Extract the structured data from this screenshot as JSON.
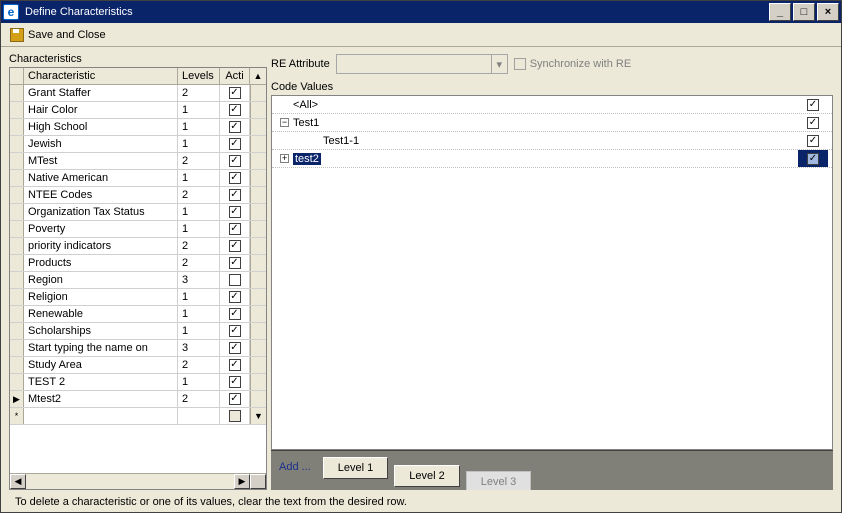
{
  "window": {
    "title": "Define Characteristics"
  },
  "toolbar": {
    "save_close": "Save and Close"
  },
  "left": {
    "heading": "Characteristics",
    "columns": {
      "char": "Characteristic",
      "levels": "Levels",
      "active": "Acti"
    },
    "rows": [
      {
        "name": "Grant Staffer",
        "levels": "2",
        "active": true,
        "marker": ""
      },
      {
        "name": "Hair Color",
        "levels": "1",
        "active": true,
        "marker": ""
      },
      {
        "name": "High School",
        "levels": "1",
        "active": true,
        "marker": ""
      },
      {
        "name": "Jewish",
        "levels": "1",
        "active": true,
        "marker": ""
      },
      {
        "name": "MTest",
        "levels": "2",
        "active": true,
        "marker": ""
      },
      {
        "name": "Native American",
        "levels": "1",
        "active": true,
        "marker": ""
      },
      {
        "name": "NTEE Codes",
        "levels": "2",
        "active": true,
        "marker": ""
      },
      {
        "name": "Organization Tax Status",
        "levels": "1",
        "active": true,
        "marker": ""
      },
      {
        "name": "Poverty",
        "levels": "1",
        "active": true,
        "marker": ""
      },
      {
        "name": "priority indicators",
        "levels": "2",
        "active": true,
        "marker": ""
      },
      {
        "name": "Products",
        "levels": "2",
        "active": true,
        "marker": ""
      },
      {
        "name": "Region",
        "levels": "3",
        "active": false,
        "marker": ""
      },
      {
        "name": "Religion",
        "levels": "1",
        "active": true,
        "marker": ""
      },
      {
        "name": "Renewable",
        "levels": "1",
        "active": true,
        "marker": ""
      },
      {
        "name": "Scholarships",
        "levels": "1",
        "active": true,
        "marker": ""
      },
      {
        "name": "Start typing the name on",
        "levels": "3",
        "active": true,
        "marker": ""
      },
      {
        "name": "Study Area",
        "levels": "2",
        "active": true,
        "marker": ""
      },
      {
        "name": "TEST 2",
        "levels": "1",
        "active": true,
        "marker": ""
      },
      {
        "name": "Mtest2",
        "levels": "2",
        "active": true,
        "marker": "▶"
      }
    ]
  },
  "right": {
    "attr_label": "RE Attribute",
    "sync_label": "Synchronize with RE",
    "code_values_label": "Code Values",
    "tree": [
      {
        "indent": 0,
        "expander": "",
        "label": "<All>",
        "checked": true,
        "selected": false
      },
      {
        "indent": 0,
        "expander": "-",
        "label": "Test1",
        "checked": true,
        "selected": false
      },
      {
        "indent": 1,
        "expander": "",
        "label": "Test1-1",
        "checked": true,
        "selected": false
      },
      {
        "indent": 0,
        "expander": "+",
        "label": "test2",
        "checked": true,
        "selected": true
      }
    ],
    "add_label": "Add ...",
    "level_buttons": [
      "Level 1",
      "Level 2",
      "Level 3"
    ]
  },
  "footer": {
    "hint": "To delete a characteristic or one of its values, clear the text from the desired row."
  }
}
